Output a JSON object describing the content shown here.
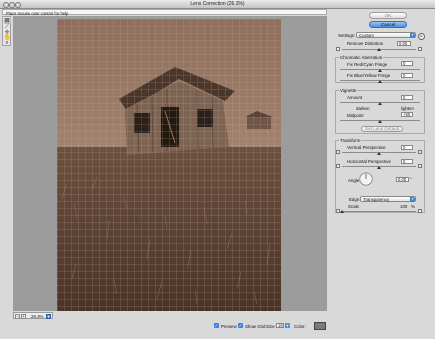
{
  "window": {
    "title": "Lens Correction (26.3%)"
  },
  "hint": {
    "text": "Place mouse over control for help"
  },
  "tools": [
    "remove-distortion-tool",
    "straighten-tool",
    "move-grid-tool",
    "hand-tool",
    "zoom-tool"
  ],
  "zoom": {
    "value": "26.3%",
    "minus": "–",
    "plus": "+"
  },
  "bottom": {
    "preview_label": "Preview",
    "show_grid_label": "Show Grid",
    "size_label": "Size:",
    "size_value": "16",
    "color_label": "Color:"
  },
  "buttons": {
    "ok": "OK",
    "cancel": "Cancel"
  },
  "settings": {
    "label": "Settings:",
    "value": "Custom"
  },
  "remove_distortion": {
    "label": "Remove Distortion",
    "value": "0.00",
    "level": 0.5
  },
  "chromatic": {
    "legend": "Chromatic Aberration",
    "red_cyan": {
      "label": "Fix Red/Cyan Fringe",
      "value": "0",
      "level": 0.5
    },
    "blue_yellow": {
      "label": "Fix Blue/Yellow Fringe",
      "value": "0",
      "level": 0.5
    }
  },
  "vignette": {
    "legend": "Vignette",
    "amount": {
      "label": "Amount",
      "value": "0",
      "level": 0.5
    },
    "darken": "darken",
    "lighten": "lighten",
    "midpoint": {
      "label": "Midpoint",
      "value": "+50",
      "level": 0.5
    },
    "set_default": "Set Lens Default"
  },
  "transform": {
    "legend": "Transform",
    "vertical": {
      "label": "Vertical Perspective",
      "value": "0",
      "level": 0.5
    },
    "horizontal": {
      "label": "Horizontal Perspective",
      "value": "0",
      "level": 0.5
    },
    "angle": {
      "label": "Angle:",
      "value": "0.00",
      "unit": "°"
    },
    "edge": {
      "label": "Edge:",
      "value": "Transparency"
    },
    "scale": {
      "label": "Scale",
      "value": "100",
      "unit": "%",
      "level": 0.0
    }
  },
  "colors": {
    "accent": "#3d7fd9",
    "photo_tone": "#8a6a55"
  }
}
